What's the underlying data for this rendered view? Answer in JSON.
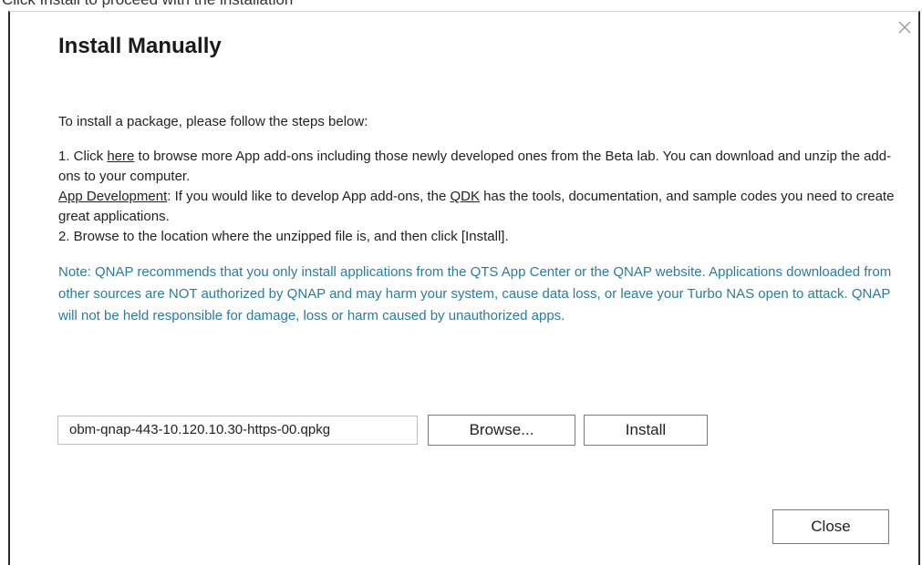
{
  "background_fragment": "Click Install to proceed with the installation",
  "dialog": {
    "title": "Install Manually",
    "intro": "To install a package, please follow the steps below:",
    "step1": {
      "prefix": "1. Click ",
      "link": "here",
      "suffix": " to browse more App add-ons including those newly developed ones from the Beta lab. You can download and unzip the add-ons to your computer."
    },
    "app_dev": {
      "link": "App Development",
      "text1": ": If you would like to develop App add-ons, the ",
      "qdk_link": "QDK",
      "text2": " has the tools, documentation, and sample codes you need to create great applications."
    },
    "step2": "2. Browse to the location where the unzipped file is, and then click [Install].",
    "note": "Note: QNAP recommends that you only install applications from the QTS App Center or the QNAP website. Applications downloaded from other sources are NOT authorized by QNAP and may harm your system, cause data loss, or leave your Turbo NAS open to attack. QNAP will not be held responsible for damage, loss or harm caused by unauthorized apps.",
    "file_value": "obm-qnap-443-10.120.10.30-https-00.qpkg",
    "browse_label": "Browse...",
    "install_label": "Install",
    "close_label": "Close"
  },
  "icons": {
    "close": "close-icon"
  },
  "colors": {
    "note": "#2a7ca0",
    "border": "#2b2b2b",
    "title": "#1a1a1a"
  }
}
